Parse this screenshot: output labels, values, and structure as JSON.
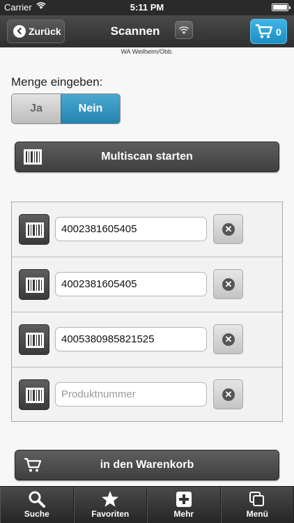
{
  "status": {
    "carrier": "Carrier",
    "time": "5:11 PM"
  },
  "nav": {
    "back_label": "Zurück",
    "title": "Scannen",
    "cart_count": "0"
  },
  "location": "WA Weilheim/Obb.",
  "quantity": {
    "label": "Menge eingeben:",
    "yes": "Ja",
    "no": "Nein",
    "selected": "Nein"
  },
  "multiscan_label": "Multiscan starten",
  "scan_rows": [
    {
      "value": "4002381605405",
      "placeholder": ""
    },
    {
      "value": "4002381605405",
      "placeholder": ""
    },
    {
      "value": "4005380985821525",
      "placeholder": ""
    },
    {
      "value": "",
      "placeholder": "Produktnummer"
    }
  ],
  "add_to_cart_label": "in den Warenkorb",
  "tabs": [
    {
      "label": "Suche",
      "icon": "search-icon"
    },
    {
      "label": "Favoriten",
      "icon": "star-icon"
    },
    {
      "label": "Mehr",
      "icon": "plus-icon"
    },
    {
      "label": "Menü",
      "icon": "windows-icon"
    }
  ],
  "colors": {
    "accent": "#2583b0",
    "cart": "#1d8fc6",
    "bar": "#3a3a3a"
  }
}
